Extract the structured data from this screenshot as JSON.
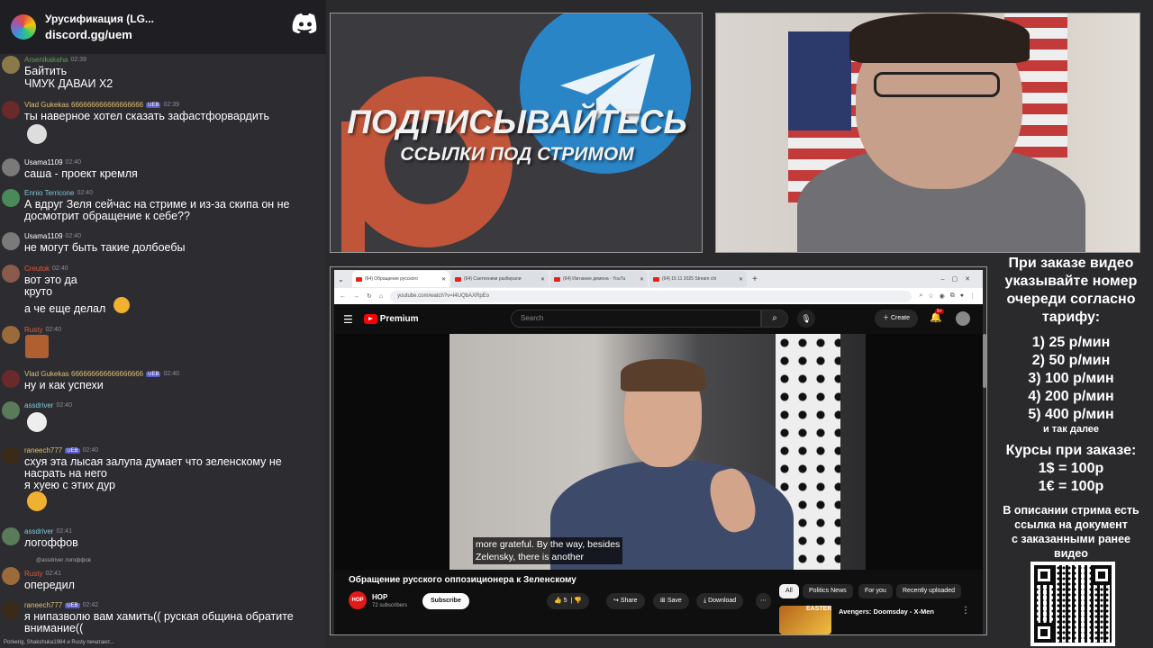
{
  "discord_banner": {
    "server_name": "Урусификация (LG...",
    "server_link": "discord.gg/uem"
  },
  "chat": {
    "messages": [
      {
        "user": "Arsenikakaha",
        "user_color": "#5fa04e",
        "time": "02:39",
        "lines": [
          "Байтить",
          "ЧМУК ДАВАИ Х2"
        ]
      },
      {
        "user": "Vlad Gukekas 666666666666666666",
        "user_color": "#e0c070",
        "badge": "UEB",
        "time": "02:39",
        "lines": [
          "ты наверное хотел сказать зафастфорвардить"
        ]
      },
      {
        "user": "Usama1109",
        "user_color": "#ffffff",
        "time": "02:40",
        "lines": [
          "саша - проект кремля"
        ]
      },
      {
        "user": "Ennio Terricone",
        "user_color": "#7fc8d8",
        "time": "02:40",
        "lines": [
          "А вдруг Зеля сейчас на стриме и из-за скипа он не",
          "досмотрит обращение к себе??"
        ]
      },
      {
        "user": "Usama1109",
        "user_color": "#ffffff",
        "time": "02:40",
        "lines": [
          "не могут быть такие долбоебы"
        ]
      },
      {
        "user": "Creutok",
        "user_color": "#e05a3a",
        "time": "02:40",
        "lines": [
          "вот это да",
          "круто",
          "а че еще делал"
        ]
      },
      {
        "user": "Rusty",
        "user_color": "#e05a3a",
        "time": "02:40",
        "lines": []
      },
      {
        "user": "Vlad Gukekas 666666666666666666",
        "user_color": "#e0c070",
        "badge": "UEB",
        "time": "02:40",
        "lines": [
          "ну и как успехи"
        ]
      },
      {
        "user": "assdriver",
        "user_color": "#7fc8d8",
        "time": "02:40",
        "lines": []
      },
      {
        "user": "raneech777",
        "user_color": "#e0c070",
        "badge": "UEB",
        "time": "02:40",
        "lines": [
          "схуя эта лысая залупа думает что зеленскому не",
          "насрать на него",
          "я хуею с этих дур"
        ]
      },
      {
        "user": "assdriver",
        "user_color": "#7fc8d8",
        "time": "02:41",
        "lines": [
          "логоффов"
        ]
      },
      {
        "user": "Rusty",
        "user_color": "#e05a3a",
        "time": "02:41",
        "reply": "@assdriver логоффов",
        "lines": [
          "опередил"
        ]
      },
      {
        "user": "raneech777",
        "user_color": "#e0c070",
        "badge": "UEB",
        "time": "02:42",
        "lines": [
          "я нипазволю вам хамить(( руская община обратите",
          "внимание(("
        ]
      }
    ],
    "typing": "Porkerig, Shakshuka1984 и Rusty печатают..."
  },
  "promo": {
    "headline": "ПОДПИСЫВАЙТЕСЬ",
    "subline": "ССЫЛКИ ПОД СТРИМОМ"
  },
  "browser": {
    "tabs": [
      {
        "label": "(64) Обращение русского",
        "active": true
      },
      {
        "label": "(64) Сантехники разбирали",
        "active": false
      },
      {
        "label": "(64) Изгнание демона - YouTu",
        "active": false
      },
      {
        "label": "(64) 15 11 2025 Stream chi",
        "active": false
      }
    ],
    "url": "youtube.com/watch?v=I4UQbAXRpEo",
    "yt_logo_text": "Premium",
    "search_placeholder": "Search",
    "create_label": "Create",
    "notif_count": "9+",
    "subtitle_lines": [
      "more grateful.  By the way, besides",
      "Zelensky, there is another"
    ],
    "video_title": "Обращение русского оппозиционера к Зеленскому",
    "channel_avatar_text": "HOP",
    "channel_name": "HOP",
    "channel_subs": "72 subscribers",
    "subscribe_label": "Subscribe",
    "like_count": "5",
    "share_label": "Share",
    "save_label": "Save",
    "download_label": "Download",
    "chips": [
      "All",
      "Politics News",
      "For you",
      "Recently uploaded"
    ],
    "rec_thumb_text": "EASTER",
    "rec_title": "Avengers: Doomsday - X-Men"
  },
  "info": {
    "lines": [
      "При заказе видео",
      "указывайте номер",
      "очереди согласно",
      "тарифу:",
      "1) 25 р/мин",
      "2) 50 р/мин",
      "3) 100 р/мин",
      "4) 200 р/мин",
      "5) 400 р/мин",
      "и так далее",
      "Курсы при заказе:",
      "1$ = 100р",
      "1€ = 100р",
      "В описании стрима есть",
      "ссылка на документ",
      "с заказанными ранее",
      "видео"
    ]
  },
  "colors": {
    "patreon": "#c1553a",
    "telegram": "#2a85c7",
    "discord": "#ffffff",
    "yt_red": "#ff0000"
  }
}
